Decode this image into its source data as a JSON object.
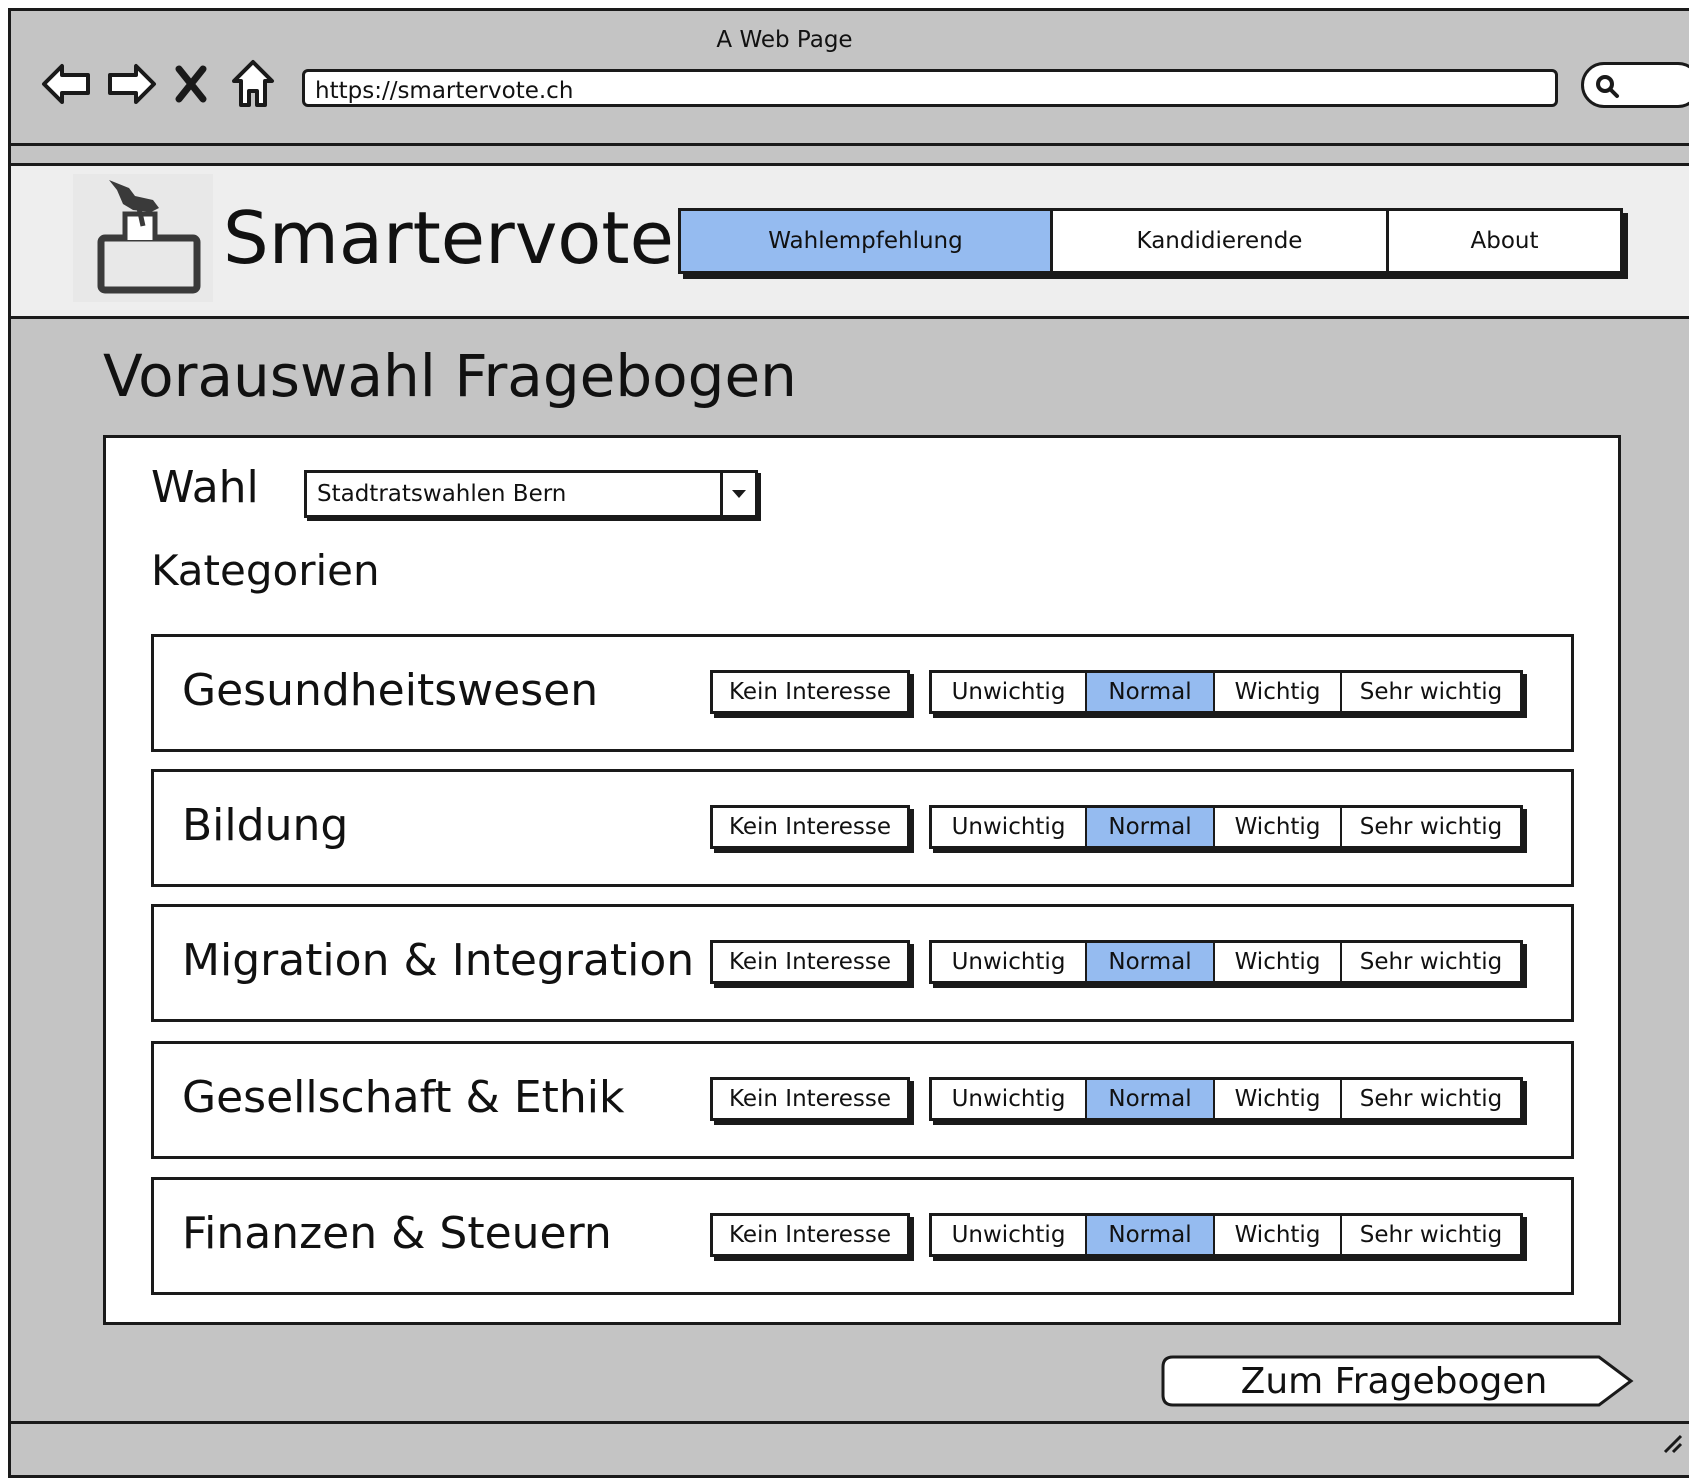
{
  "window": {
    "title": "A Web Page"
  },
  "browser": {
    "url": "https://smartervote.ch"
  },
  "header": {
    "brand": "Smartervote",
    "nav": [
      {
        "label": "Wahlempfehlung",
        "active": true
      },
      {
        "label": "Kandidierende",
        "active": false
      },
      {
        "label": "About",
        "active": false
      }
    ]
  },
  "main": {
    "title": "Vorauswahl Fragebogen",
    "wahl_label": "Wahl",
    "wahl_value": "Stadtratswahlen Bern",
    "kategorien_label": "Kategorien",
    "no_interest_label": "Kein Interesse",
    "levels": [
      "Unwichtig",
      "Normal",
      "Wichtig",
      "Sehr wichtig"
    ],
    "categories": [
      {
        "name": "Gesundheitswesen",
        "selected": "Normal"
      },
      {
        "name": "Bildung",
        "selected": "Normal"
      },
      {
        "name": "Migration & Integration",
        "selected": "Normal"
      },
      {
        "name": "Gesellschaft & Ethik",
        "selected": "Normal"
      },
      {
        "name": "Finanzen & Steuern",
        "selected": "Normal"
      }
    ],
    "cta_label": "Zum Fragebogen"
  },
  "colors": {
    "accent": "#95bbf0",
    "background": "#c4c4c4",
    "header_bg": "#eeeeee"
  },
  "icons": [
    "back-arrow-icon",
    "forward-arrow-icon",
    "close-icon",
    "home-icon",
    "search-icon",
    "ballot-box-icon",
    "chevron-down-icon",
    "resize-grip-icon"
  ]
}
